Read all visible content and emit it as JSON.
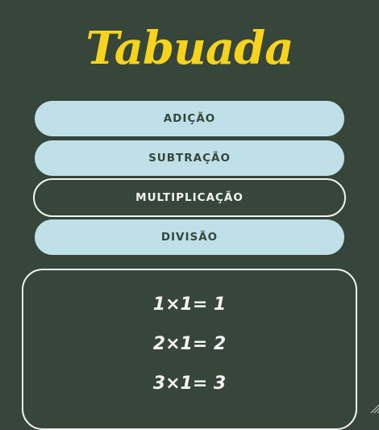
{
  "header": {
    "title": "Tabuada"
  },
  "menu": {
    "items": [
      {
        "label": "ADIÇÃO",
        "active": false
      },
      {
        "label": "SUBTRAÇÃO",
        "active": false
      },
      {
        "label": "MULTIPLICAÇÃO",
        "active": true
      },
      {
        "label": "DIVISÃO",
        "active": false
      }
    ]
  },
  "results": {
    "lines": [
      "1×1= 1",
      "2×1= 2",
      "3×1= 3"
    ]
  },
  "colors": {
    "background": "#36463b",
    "title": "#f7d31c",
    "button": "#bfe0e8",
    "button_text": "#36463b",
    "light": "#f3f3f3"
  },
  "icons": {
    "resize": "resize-grip-icon"
  }
}
